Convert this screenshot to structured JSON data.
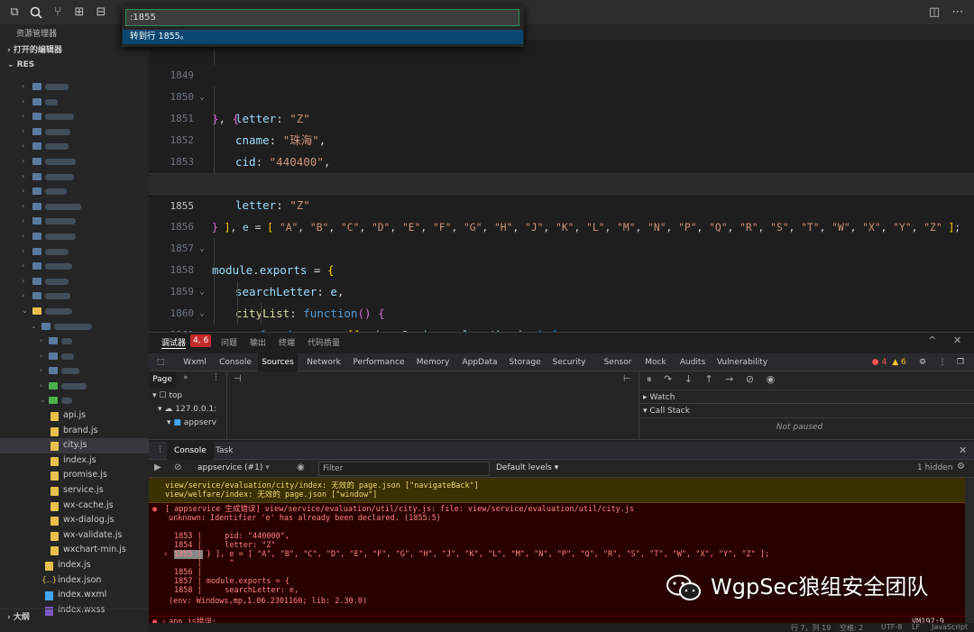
{
  "quick_open": {
    "input_value": ":1855",
    "result": "转到行 1855。"
  },
  "sidebar": {
    "title": "资源管理器",
    "open_editors": "打开的编辑器",
    "root": "RES",
    "outline": "大纲",
    "files": [
      "api.js",
      "brand.js",
      "city.js",
      "index.js",
      "promise.js",
      "service.js",
      "wx-cache.js",
      "wx-dialog.js",
      "wx-validate.js",
      "wxchart-min.js"
    ],
    "root_files": [
      "index.js",
      "index.json",
      "index.wxml",
      "index.wxss"
    ]
  },
  "editor": {
    "lines": [
      {
        "n": "1849",
        "text": "letter: \"Z\""
      },
      {
        "n": "1850",
        "text": "}, {"
      },
      {
        "n": "1851",
        "text": "cname: \"珠海\","
      },
      {
        "n": "1852",
        "text": "cid: \"440400\","
      },
      {
        "n": "1853",
        "text": "pid: \"440000\","
      },
      {
        "n": "1854",
        "text": "letter: \"Z\""
      },
      {
        "n": "1855",
        "text": "} ], e = [ \"A\", \"B\", \"C\", \"D\", \"E\", \"F\", \"G\", \"H\", \"J\", \"K\", \"L\", \"M\", \"N\", \"P\", \"Q\", \"R\", \"S\", \"T\", \"W\", \"X\", \"Y\", \"Z\" ];"
      },
      {
        "n": "1856",
        "text": ""
      },
      {
        "n": "1857",
        "text": "module.exports = {"
      },
      {
        "n": "1858",
        "text": "searchLetter: e,"
      },
      {
        "n": "1859",
        "text": "cityList: function() {"
      },
      {
        "n": "1860",
        "text": "for (var c = [], i = 0; i < e.length; i++) {"
      },
      {
        "n": "1861",
        "text": "var d = e[i], r = [], n = {};"
      }
    ]
  },
  "panel": {
    "tabs": [
      "调试器",
      "问题",
      "输出",
      "终端",
      "代码质量"
    ],
    "badge": "4, 6",
    "devtools_tabs": [
      "Wxml",
      "Console",
      "Sources",
      "Network",
      "Performance",
      "Memory",
      "AppData",
      "Storage",
      "Security",
      "Sensor",
      "Mock",
      "Audits",
      "Vulnerability"
    ],
    "active_devtools_tab": "Sources",
    "err_count": "4",
    "warn_count": "6",
    "sources": {
      "page_tab": "Page",
      "tree": [
        "top",
        "127.0.0.1:",
        "appserv"
      ],
      "watch": "Watch",
      "call_stack": "Call Stack",
      "not_paused": "Not paused"
    },
    "console_tabs": [
      "Console",
      "Task"
    ],
    "context": "appservice (#1)",
    "filter_placeholder": "Filter",
    "levels": "Default levels",
    "hidden": "1 hidden",
    "messages": {
      "warn1": "view/service/evaluation/city/index: 无效的 page.json [\"navigateBack\"]",
      "warn2": "view/welfare/index: 无效的 page.json [\"window\"]",
      "err_title": "[ appservice 生成错误] view/service/evaluation/util/city.js: file: view/service/evaluation/util/city.js",
      "err_detail": "unknown: Identifier 'e' has already been declared. (1855:5)",
      "ctx": [
        "1853 |     pid: \"440000\",",
        "1854 |     letter: \"Z\"",
        "1855 | } ], e = [ \"A\", \"B\", \"C\", \"D\", \"E\", \"F\", \"G\", \"H\", \"J\", \"K\", \"L\", \"M\", \"N\", \"P\", \"Q\", \"R\", \"S\", \"T\", \"W\", \"X\", \"Y\", \"Z\" ];",
        "     |      ^",
        "1856 |",
        "1857 | module.exports = {",
        "1858 |     searchLetter: e,"
      ],
      "env": "(env: Windows,mp,1.06.2301160; lib: 2.30.0)",
      "err2": "app.js错误:",
      "vm": "VM197:9"
    }
  },
  "watermark": "WgpSec狼组安全团队",
  "status": {
    "pos": "行 7，列 19",
    "space": "空格: 2",
    "enc": "UTF-8",
    "eol": "LF",
    "lang": "JavaScript"
  }
}
